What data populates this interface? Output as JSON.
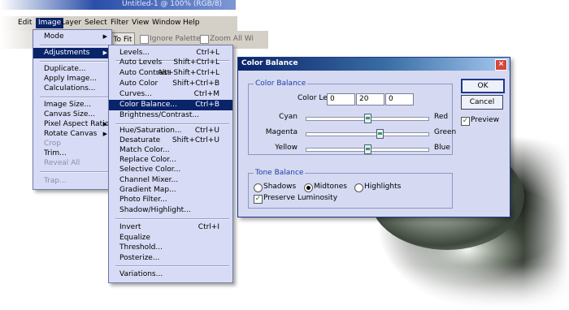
{
  "window": {
    "title": "Untitled-1 @ 100% (RGB/8)"
  },
  "menubar": {
    "items": [
      "Edit",
      "Image",
      "Layer",
      "Select",
      "Filter",
      "View",
      "Window",
      "Help"
    ],
    "active": "Image"
  },
  "optbar": {
    "fit_button": "To Fit",
    "ignore_palettes": "Ignore Palettes",
    "zoom_all": "Zoom All Wi"
  },
  "image_menu": {
    "items": [
      {
        "label": "Mode",
        "submenu": true
      },
      {
        "label": "Adjustments",
        "submenu": true,
        "highlight": true
      },
      {
        "label": "Duplicate..."
      },
      {
        "label": "Apply Image..."
      },
      {
        "label": "Calculations..."
      },
      {
        "label": "Image Size..."
      },
      {
        "label": "Canvas Size..."
      },
      {
        "label": "Pixel Aspect Ratio",
        "submenu": true
      },
      {
        "label": "Rotate Canvas",
        "submenu": true
      },
      {
        "label": "Crop",
        "disabled": true
      },
      {
        "label": "Trim..."
      },
      {
        "label": "Reveal All",
        "disabled": true
      },
      {
        "label": "Trap...",
        "disabled": true
      }
    ]
  },
  "adjustments_menu": {
    "items": [
      {
        "label": "Levels...",
        "shortcut": "Ctrl+L"
      },
      {
        "label": "Auto Levels",
        "shortcut": "Shift+Ctrl+L"
      },
      {
        "label": "Auto Contrast",
        "shortcut": "Alt+Shift+Ctrl+L"
      },
      {
        "label": "Auto Color",
        "shortcut": "Shift+Ctrl+B"
      },
      {
        "label": "Curves...",
        "shortcut": "Ctrl+M"
      },
      {
        "label": "Color Balance...",
        "shortcut": "Ctrl+B",
        "highlight": true
      },
      {
        "label": "Brightness/Contrast...",
        "shortcut": ""
      },
      {
        "label": "Hue/Saturation...",
        "shortcut": "Ctrl+U"
      },
      {
        "label": "Desaturate",
        "shortcut": "Shift+Ctrl+U"
      },
      {
        "label": "Match Color...",
        "shortcut": ""
      },
      {
        "label": "Replace Color...",
        "shortcut": ""
      },
      {
        "label": "Selective Color...",
        "shortcut": ""
      },
      {
        "label": "Channel Mixer...",
        "shortcut": ""
      },
      {
        "label": "Gradient Map...",
        "shortcut": ""
      },
      {
        "label": "Photo Filter...",
        "shortcut": ""
      },
      {
        "label": "Shadow/Highlight...",
        "shortcut": ""
      },
      {
        "label": "Invert",
        "shortcut": "Ctrl+I"
      },
      {
        "label": "Equalize",
        "shortcut": ""
      },
      {
        "label": "Threshold...",
        "shortcut": ""
      },
      {
        "label": "Posterize...",
        "shortcut": ""
      },
      {
        "label": "Variations...",
        "shortcut": ""
      }
    ]
  },
  "dialog": {
    "title": "Color Balance",
    "close": "×",
    "color_balance_group": "Color Balance",
    "color_levels_label": "Color Levels:",
    "levels": [
      "0",
      "20",
      "0"
    ],
    "sliders": [
      {
        "left": "Cyan",
        "right": "Red",
        "value": 0
      },
      {
        "left": "Magenta",
        "right": "Green",
        "value": 20
      },
      {
        "left": "Yellow",
        "right": "Blue",
        "value": 0
      }
    ],
    "tone_group": "Tone Balance",
    "tones": [
      {
        "label": "Shadows",
        "selected": false
      },
      {
        "label": "Midtones",
        "selected": true
      },
      {
        "label": "Highlights",
        "selected": false
      }
    ],
    "preserve_luminosity": "Preserve Luminosity",
    "preserve_checked": true,
    "ok": "OK",
    "cancel": "Cancel",
    "preview": "Preview",
    "preview_checked": true,
    "check_mark": "✓"
  }
}
